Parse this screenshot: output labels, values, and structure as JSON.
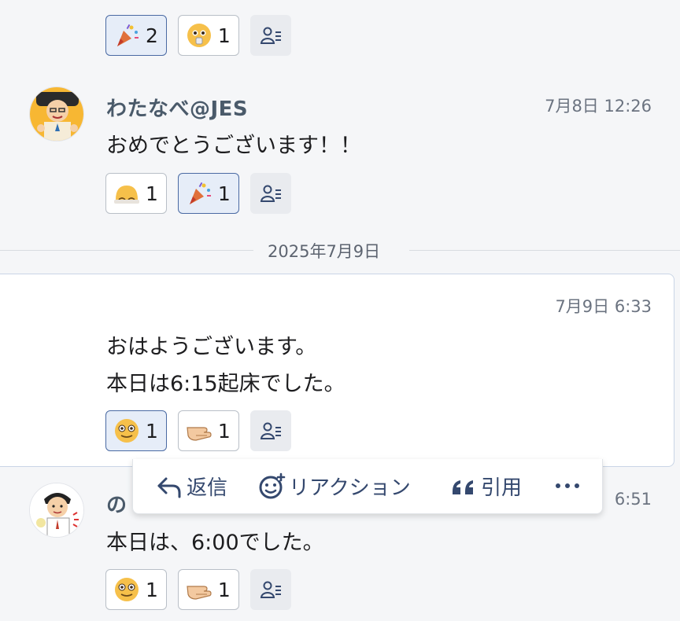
{
  "colors": {
    "accent": "#34486e",
    "mine_reaction_bg": "#e6edf8",
    "mine_reaction_border": "#4a6aa3",
    "page_bg": "#f5f6f8"
  },
  "messages": [
    {
      "reactions": [
        {
          "emoji": "party-popper-icon",
          "count": "2",
          "mine": true
        },
        {
          "emoji": "pleading-face-icon",
          "count": "1",
          "mine": false
        }
      ]
    },
    {
      "author": "わたなべ@JES",
      "time": "7月8日 12:26",
      "text_lines": [
        "おめでとうございます！！"
      ],
      "reactions": [
        {
          "emoji": "bowing-face-icon",
          "count": "1",
          "mine": false
        },
        {
          "emoji": "party-popper-icon",
          "count": "1",
          "mine": true
        }
      ]
    },
    {
      "time": "7月9日 6:33",
      "text_lines": [
        "おはようございます。",
        "本日は6:15起床でした。"
      ],
      "reactions": [
        {
          "emoji": "wow-face-icon",
          "count": "1",
          "mine": true
        },
        {
          "emoji": "pointing-hand-icon",
          "count": "1",
          "mine": false
        }
      ]
    },
    {
      "author": "の",
      "time": "6:51",
      "text_lines": [
        "本日は、6:00でした。"
      ],
      "reactions": [
        {
          "emoji": "wow-face-icon",
          "count": "1",
          "mine": false
        },
        {
          "emoji": "pointing-hand-icon",
          "count": "1",
          "mine": false
        }
      ]
    }
  ],
  "divider": {
    "date": "2025年7月9日"
  },
  "toolbar": {
    "reply": "返信",
    "reaction": "リアクション",
    "quote": "引用",
    "more_icon": "more-horizontal-icon"
  }
}
